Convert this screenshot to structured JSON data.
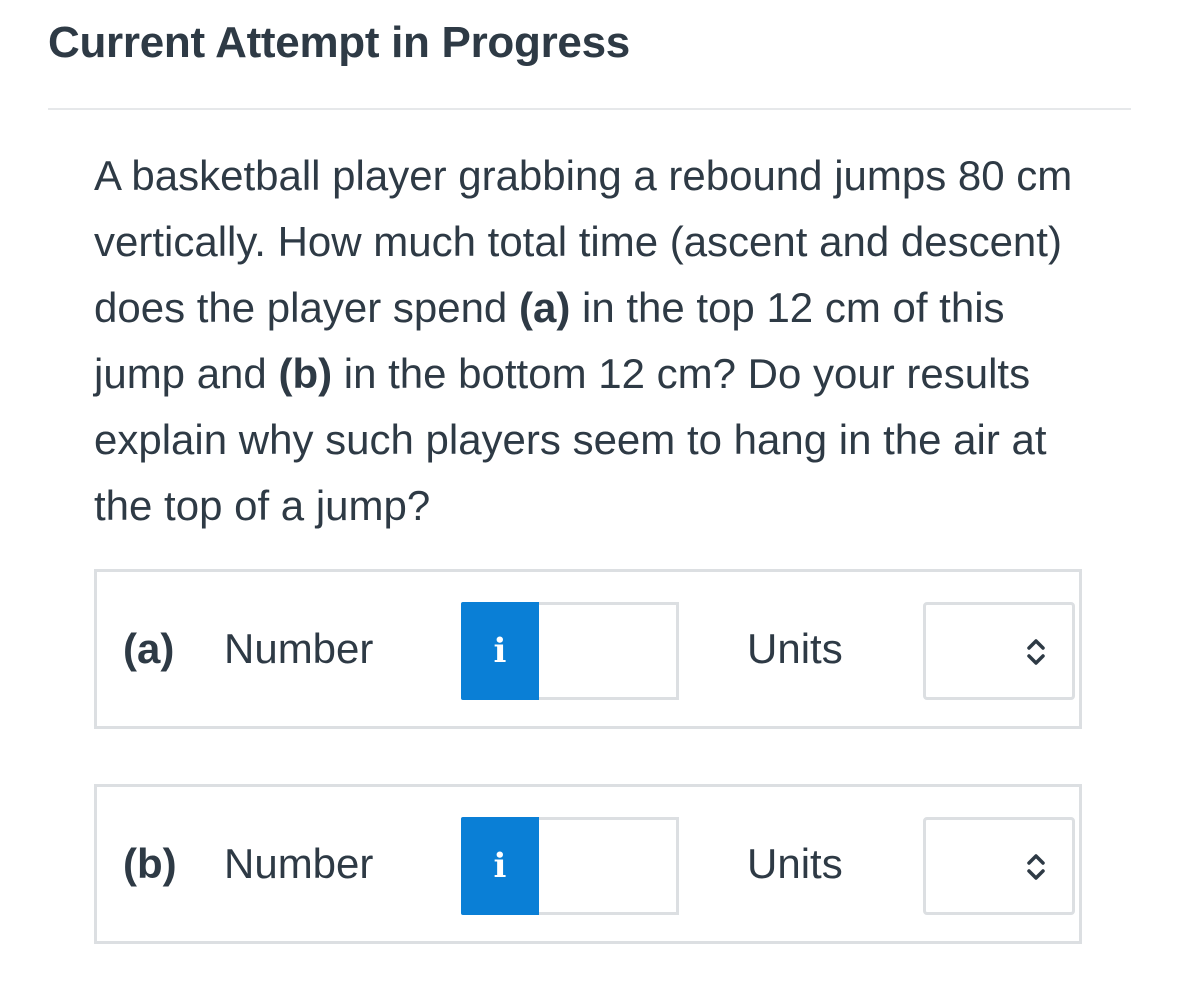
{
  "header": {
    "title": "Current Attempt in Progress"
  },
  "question": {
    "text_1": "A basketball player grabbing a rebound jumps 80 cm vertically. How much total time (ascent and descent) does the player spend ",
    "part_a_marker": "(a)",
    "text_2": " in the top 12 cm of this jump and ",
    "part_b_marker": "(b)",
    "text_3": " in the bottom 12 cm? Do your results explain why such players seem to hang in the air at the top of a jump?"
  },
  "answers": [
    {
      "part_label": "(a)",
      "number_label": "Number",
      "info_icon": "i",
      "number_value": "",
      "units_label": "Units",
      "units_selected": ""
    },
    {
      "part_label": "(b)",
      "number_label": "Number",
      "info_icon": "i",
      "number_value": "",
      "units_label": "Units",
      "units_selected": ""
    }
  ],
  "colors": {
    "accent": "#0a7fd6",
    "text": "#2e3a45",
    "border": "#dcdfe2"
  }
}
